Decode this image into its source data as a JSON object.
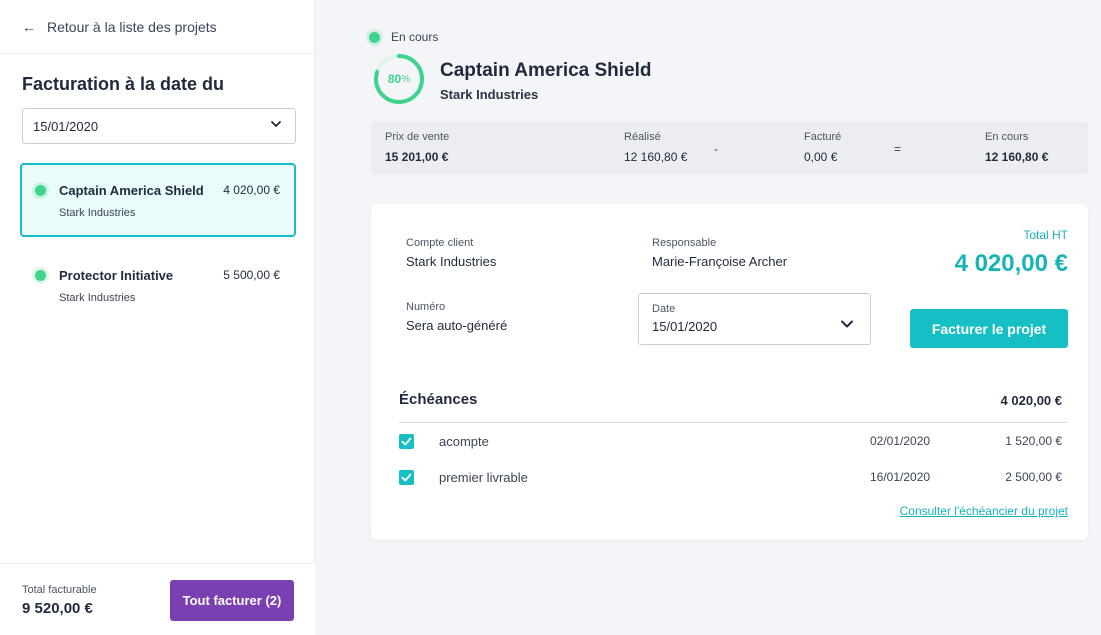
{
  "sidebar": {
    "back_label": "Retour à la liste des projets",
    "heading": "Facturation à la date du",
    "date_value": "15/01/2020",
    "projects": [
      {
        "name": "Captain America Shield",
        "client": "Stark Industries",
        "amount": "4 020,00 €"
      },
      {
        "name": "Protector Initiative",
        "client": "Stark Industries",
        "amount": "5 500,00 €"
      }
    ],
    "footer": {
      "total_label": "Total facturable",
      "total_value": "9 520,00 €",
      "button_label": "Tout facturer (2)"
    }
  },
  "project": {
    "status": "En cours",
    "progress": {
      "value": "80",
      "unit": "%"
    },
    "progress_fraction": 0.8,
    "title": "Captain America Shield",
    "client": "Stark Industries"
  },
  "summary": {
    "prix_label": "Prix de vente",
    "prix_value": "15 201,00 €",
    "realise_label": "Réalisé",
    "realise_value": "12 160,80 €",
    "op_minus": "-",
    "facture_label": "Facturé",
    "facture_value": "0,00 €",
    "op_equals": "=",
    "encours_label": "En cours",
    "encours_value": "12 160,80 €"
  },
  "invoice": {
    "compte_label": "Compte client",
    "compte_value": "Stark Industries",
    "resp_label": "Responsable",
    "resp_value": "Marie-Françoise Archer",
    "total_label": "Total HT",
    "total_value": "4 020,00 €",
    "numero_label": "Numéro",
    "numero_value": "Sera auto-généré",
    "date_label": "Date",
    "date_value": "15/01/2020",
    "button_label": "Facturer le projet"
  },
  "echeances": {
    "title": "Échéances",
    "total": "4 020,00 €",
    "rows": [
      {
        "name": "acompte",
        "date": "02/01/2020",
        "amount": "1 520,00 €",
        "checked": true
      },
      {
        "name": "premier livrable",
        "date": "16/01/2020",
        "amount": "2 500,00 €",
        "checked": true
      }
    ],
    "link_label": "Consulter l'échéancier du projet"
  },
  "colors": {
    "accent": "#16bfc4",
    "status_green": "#3fd38c",
    "primary_purple": "#7a3fb0"
  },
  "icons": {
    "back": "arrow-left-icon",
    "dropdown": "chevron-down-icon",
    "check": "check-icon"
  }
}
